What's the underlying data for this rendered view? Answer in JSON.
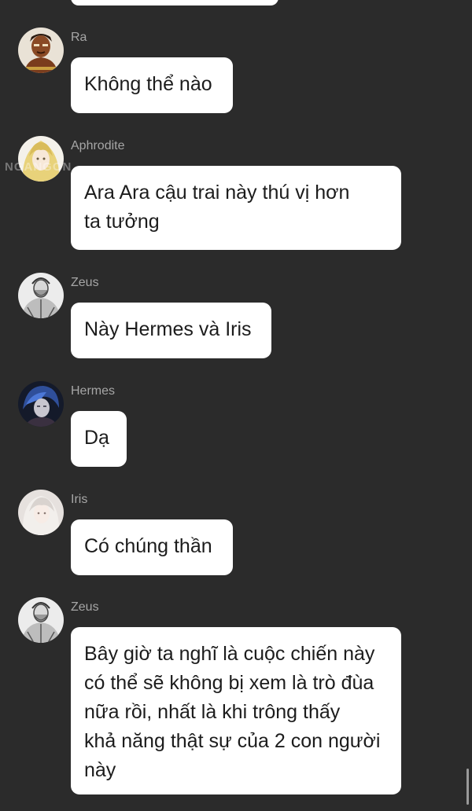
{
  "watermark": "NGANGON",
  "messages": [
    {
      "name": "Ra",
      "avatar_icon": "warrior-avatar-icon",
      "text": "Không thể nào"
    },
    {
      "name": "Aphrodite",
      "avatar_icon": "blonde-woman-avatar-icon",
      "text": "Ara Ara cậu trai này thú vị hơn\nta tưởng"
    },
    {
      "name": "Zeus",
      "avatar_icon": "sketch-man-avatar-icon",
      "text": "Này Hermes và Iris"
    },
    {
      "name": "Hermes",
      "avatar_icon": "blue-hair-man-avatar-icon",
      "text": "Dạ"
    },
    {
      "name": "Iris",
      "avatar_icon": "pale-woman-avatar-icon",
      "text": "Có chúng thần"
    },
    {
      "name": "Zeus",
      "avatar_icon": "sketch-man-avatar-icon",
      "text": "Bây giờ ta nghĩ là cuộc chiến này\ncó thể sẽ không bị xem là trò đùa\nnữa rồi, nhất là khi trông thấy\nkhả năng thật sự của 2 con người\nnày"
    }
  ]
}
